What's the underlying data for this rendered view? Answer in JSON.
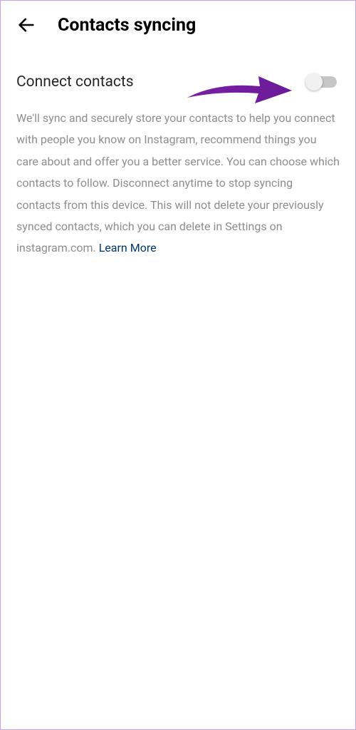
{
  "header": {
    "title": "Contacts syncing"
  },
  "setting": {
    "label": "Connect contacts",
    "toggle_state": "off"
  },
  "description": {
    "text": "We'll sync and securely store your contacts to help you connect with people you know on Instagram, recommend things you care about and offer you a better service. You can choose which contacts to follow. Disconnect anytime to stop syncing contacts from this device. This will not delete your previously synced contacts, which you can delete in Settings on instagram.com. ",
    "learn_more_label": "Learn More"
  },
  "annotation": {
    "arrow_color": "#7b1fa2"
  }
}
